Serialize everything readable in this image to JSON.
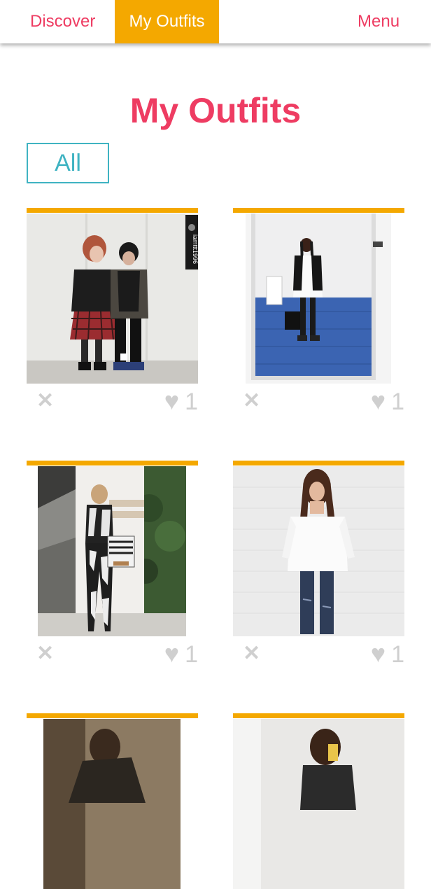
{
  "nav": {
    "discover": "Discover",
    "my_outfits": "My Outfits",
    "menu": "Menu"
  },
  "page": {
    "title": "My Outfits",
    "filter": "All"
  },
  "icons": {
    "remove": "close-icon",
    "like": "heart-icon"
  },
  "colors": {
    "accent_pink": "#ee3c62",
    "accent_orange": "#f4a800",
    "accent_teal": "#3fb3c2",
    "icon_gray": "#cfcfcf"
  },
  "outfits": [
    {
      "likes": "1",
      "photo_watermark": "iamttt1996"
    },
    {
      "likes": "1"
    },
    {
      "likes": "1"
    },
    {
      "likes": "1"
    },
    {},
    {}
  ]
}
